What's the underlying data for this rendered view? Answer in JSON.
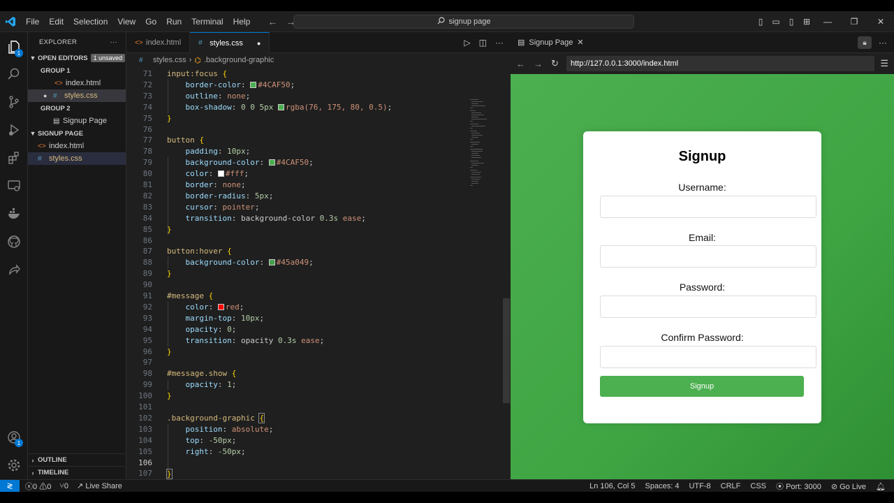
{
  "titlebar": {
    "menu": [
      "File",
      "Edit",
      "Selection",
      "View",
      "Go",
      "Run",
      "Terminal",
      "Help"
    ],
    "search": "signup page"
  },
  "sidebar": {
    "title": "EXPLORER",
    "open_editors": "OPEN EDITORS",
    "unsaved": "1 unsaved",
    "group1": "GROUP 1",
    "group1_file1": "index.html",
    "group1_file2": "styles.css",
    "group2": "GROUP 2",
    "group2_file1": "Signup Page",
    "project": "SIGNUP PAGE",
    "project_file1": "index.html",
    "project_file2": "styles.css",
    "outline": "OUTLINE",
    "timeline": "TIMELINE"
  },
  "editor": {
    "tabs": [
      "index.html",
      "styles.css"
    ],
    "breadcrumb_file": "styles.css",
    "breadcrumb_symbol": ".background-graphic",
    "lines": [
      {
        "n": "71"
      },
      {
        "n": "72"
      },
      {
        "n": "73"
      },
      {
        "n": "74"
      },
      {
        "n": "75"
      },
      {
        "n": "76"
      },
      {
        "n": "77"
      },
      {
        "n": "78"
      },
      {
        "n": "79"
      },
      {
        "n": "80"
      },
      {
        "n": "81"
      },
      {
        "n": "82"
      },
      {
        "n": "83"
      },
      {
        "n": "84"
      },
      {
        "n": "85"
      },
      {
        "n": "86"
      },
      {
        "n": "87"
      },
      {
        "n": "88"
      },
      {
        "n": "89"
      },
      {
        "n": "90"
      },
      {
        "n": "91"
      },
      {
        "n": "92"
      },
      {
        "n": "93"
      },
      {
        "n": "94"
      },
      {
        "n": "95"
      },
      {
        "n": "96"
      },
      {
        "n": "97"
      },
      {
        "n": "98"
      },
      {
        "n": "99"
      },
      {
        "n": "100"
      },
      {
        "n": "101"
      },
      {
        "n": "102"
      },
      {
        "n": "103"
      },
      {
        "n": "104"
      },
      {
        "n": "105"
      },
      {
        "n": "106"
      },
      {
        "n": "107"
      }
    ],
    "code": {
      "l71_sel": "input:focus",
      "l71_b": "{",
      "l72_p": "border-color",
      "l72_v": "#4CAF50",
      "l73_p": "outline",
      "l73_v": "none",
      "l74_p": "box-shadow",
      "l74_n": "0 0 5px",
      "l74_v": "rgba(76, 175, 80, 0.5)",
      "l75_b": "}",
      "l77_sel": "button",
      "l77_b": "{",
      "l78_p": "padding",
      "l78_v": "10px",
      "l79_p": "background-color",
      "l79_v": "#4CAF50",
      "l80_p": "color",
      "l80_v": "#fff",
      "l81_p": "border",
      "l81_v": "none",
      "l82_p": "border-radius",
      "l82_v": "5px",
      "l83_p": "cursor",
      "l83_v": "pointer",
      "l84_p": "transition",
      "l84_v1": "background-color",
      "l84_v2": "0.3s",
      "l84_v3": "ease",
      "l85_b": "}",
      "l87_sel": "button:hover",
      "l87_b": "{",
      "l88_p": "background-color",
      "l88_v": "#45a049",
      "l89_b": "}",
      "l91_sel": "#message",
      "l91_b": "{",
      "l92_p": "color",
      "l92_v": "red",
      "l93_p": "margin-top",
      "l93_v": "10px",
      "l94_p": "opacity",
      "l94_v": "0",
      "l95_p": "transition",
      "l95_v1": "opacity",
      "l95_v2": "0.3s",
      "l95_v3": "ease",
      "l96_b": "}",
      "l98_sel": "#message.show",
      "l98_b": "{",
      "l99_p": "opacity",
      "l99_v": "1",
      "l100_b": "}",
      "l102_sel": ".background-graphic",
      "l102_b": "{",
      "l103_p": "position",
      "l103_v": "absolute",
      "l104_p": "top",
      "l104_v": "-50px",
      "l105_p": "right",
      "l105_v": "-50px",
      "l107_b": "}"
    }
  },
  "browser": {
    "tab_title": "Signup Page",
    "url": "http://127.0.0.1:3000/index.html",
    "page": {
      "heading": "Signup",
      "username_label": "Username:",
      "email_label": "Email:",
      "password_label": "Password:",
      "confirm_label": "Confirm Password:",
      "button": "Signup"
    }
  },
  "statusbar": {
    "errors": "0",
    "warnings": "0",
    "ports_count": "0",
    "live_share": "Live Share",
    "position": "Ln 106, Col 5",
    "spaces": "Spaces: 4",
    "encoding": "UTF-8",
    "eol": "CRLF",
    "language": "CSS",
    "port": "Port: 3000",
    "go_live": "Go Live"
  },
  "colors": {
    "accent": "#0078d4",
    "green": "#4CAF50",
    "green_hover": "#45a049",
    "swatch_white": "#ffffff",
    "swatch_red": "#ff0000"
  }
}
